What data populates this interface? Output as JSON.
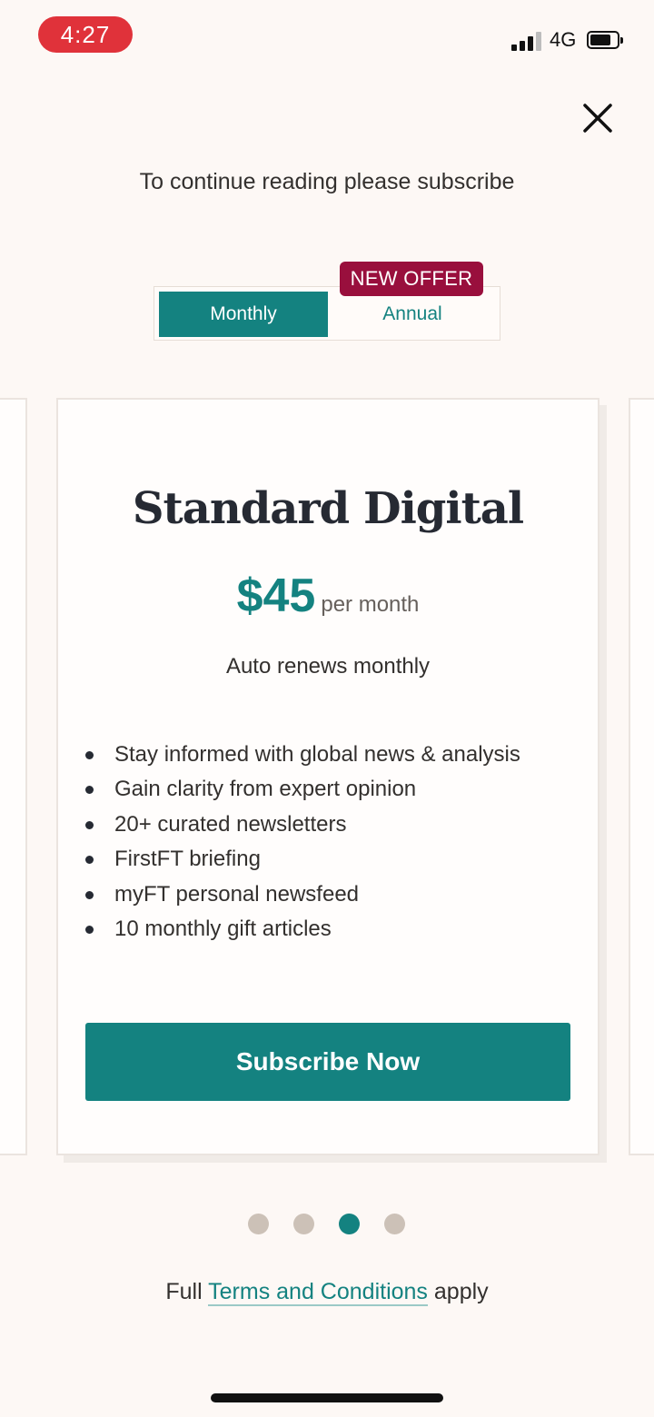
{
  "status_bar": {
    "time": "4:27",
    "network": "4G",
    "signal_icon": "signal-bars-icon",
    "battery_icon": "battery-icon"
  },
  "dialog": {
    "close_icon": "close-icon",
    "prompt": "To continue reading please subscribe"
  },
  "billing_toggle": {
    "options": [
      {
        "label": "Monthly",
        "selected": true
      },
      {
        "label": "Annual",
        "selected": false
      }
    ],
    "badge": "NEW OFFER"
  },
  "plan": {
    "name": "Standard Digital",
    "price": "$45",
    "period": "per month",
    "renewal": "Auto renews monthly",
    "features": [
      "Stay informed with global news & analysis",
      "Gain clarity from expert opinion",
      "20+ curated newsletters",
      "FirstFT briefing",
      "myFT personal newsfeed",
      "10 monthly gift articles"
    ],
    "cta": "Subscribe Now"
  },
  "pagination": {
    "total": 4,
    "active_index": 2
  },
  "footer": {
    "prefix": "Full",
    "link": "Terms and Conditions",
    "suffix": "apply"
  },
  "colors": {
    "accent": "#148280",
    "badge": "#990f3d",
    "background": "#fdf8f5",
    "time_pill": "#e0323a"
  }
}
